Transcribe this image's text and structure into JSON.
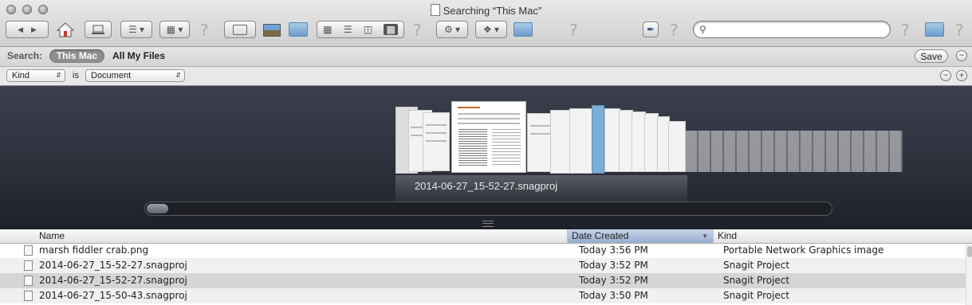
{
  "window": {
    "title": "Searching “This Mac”"
  },
  "toolbar": {
    "back_icon": "◀",
    "forward_icon": "▶",
    "home_icon": "house-icon",
    "computer_icon": "computer-icon",
    "help_mark": "?",
    "search_placeholder": "",
    "search_value": ""
  },
  "scope": {
    "label": "Search:",
    "this_mac": "This Mac",
    "all_files": "All My Files",
    "save": "Save"
  },
  "criteria": {
    "attribute": "Kind",
    "operator": "is",
    "value": "Document"
  },
  "coverflow": {
    "caption": "2014-06-27_15-52-27.snagproj"
  },
  "list": {
    "columns": [
      "Name",
      "Date Created",
      "Kind"
    ],
    "sorted_column": "Date Created",
    "rows": [
      {
        "name": "marsh fiddler crab.png",
        "date": "Today 3:56 PM",
        "kind": "Portable Network Graphics image"
      },
      {
        "name": "2014-06-27_15-52-27.snagproj",
        "date": "Today 3:52 PM",
        "kind": "Snagit Project"
      },
      {
        "name": "2014-06-27_15-52-27.snagproj",
        "date": "Today 3:52 PM",
        "kind": "Snagit Project"
      },
      {
        "name": "2014-06-27_15-50-43.snagproj",
        "date": "Today 3:50 PM",
        "kind": "Snagit Project"
      }
    ]
  },
  "colors": {
    "coverflow_bg": "#2e313c",
    "selected_header": "#97add0"
  }
}
